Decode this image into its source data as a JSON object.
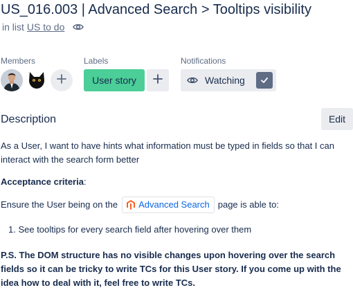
{
  "card": {
    "title": "US_016.003 | Advanced Search > Tooltips visibility",
    "in_list_prefix": "in list",
    "list_name": "US to do"
  },
  "members": {
    "label": "Members"
  },
  "labels": {
    "label": "Labels",
    "items": [
      {
        "text": "User story",
        "color": "#4bce97"
      }
    ]
  },
  "notifications": {
    "label": "Notifications",
    "watch_label": "Watching",
    "watching": true
  },
  "description": {
    "heading": "Description",
    "edit_label": "Edit",
    "paragraph1": "As a User, I want to have hints what information must be typed in fields so that I can interact with the search form better",
    "acceptance_bold": "Acceptance criteria",
    "acceptance_colon": ":",
    "ensure_prefix": "Ensure the User being on the",
    "ensure_link": "Advanced Search",
    "ensure_suffix": "page is able to:",
    "list_items": [
      "1. See tooltips for every search field after hovering over them"
    ],
    "ps": "P.S. The DOM structure has no visible changes upon hovering over the search fields so it can be tricky to write TCs for this User story. If you come up with the idea how to deal with it, feel free to write TCs."
  },
  "colors": {
    "label_green": "#4bce97",
    "link_blue": "#0c66e4",
    "button_bg": "#ebecf0",
    "magento_orange": "#f26322"
  }
}
